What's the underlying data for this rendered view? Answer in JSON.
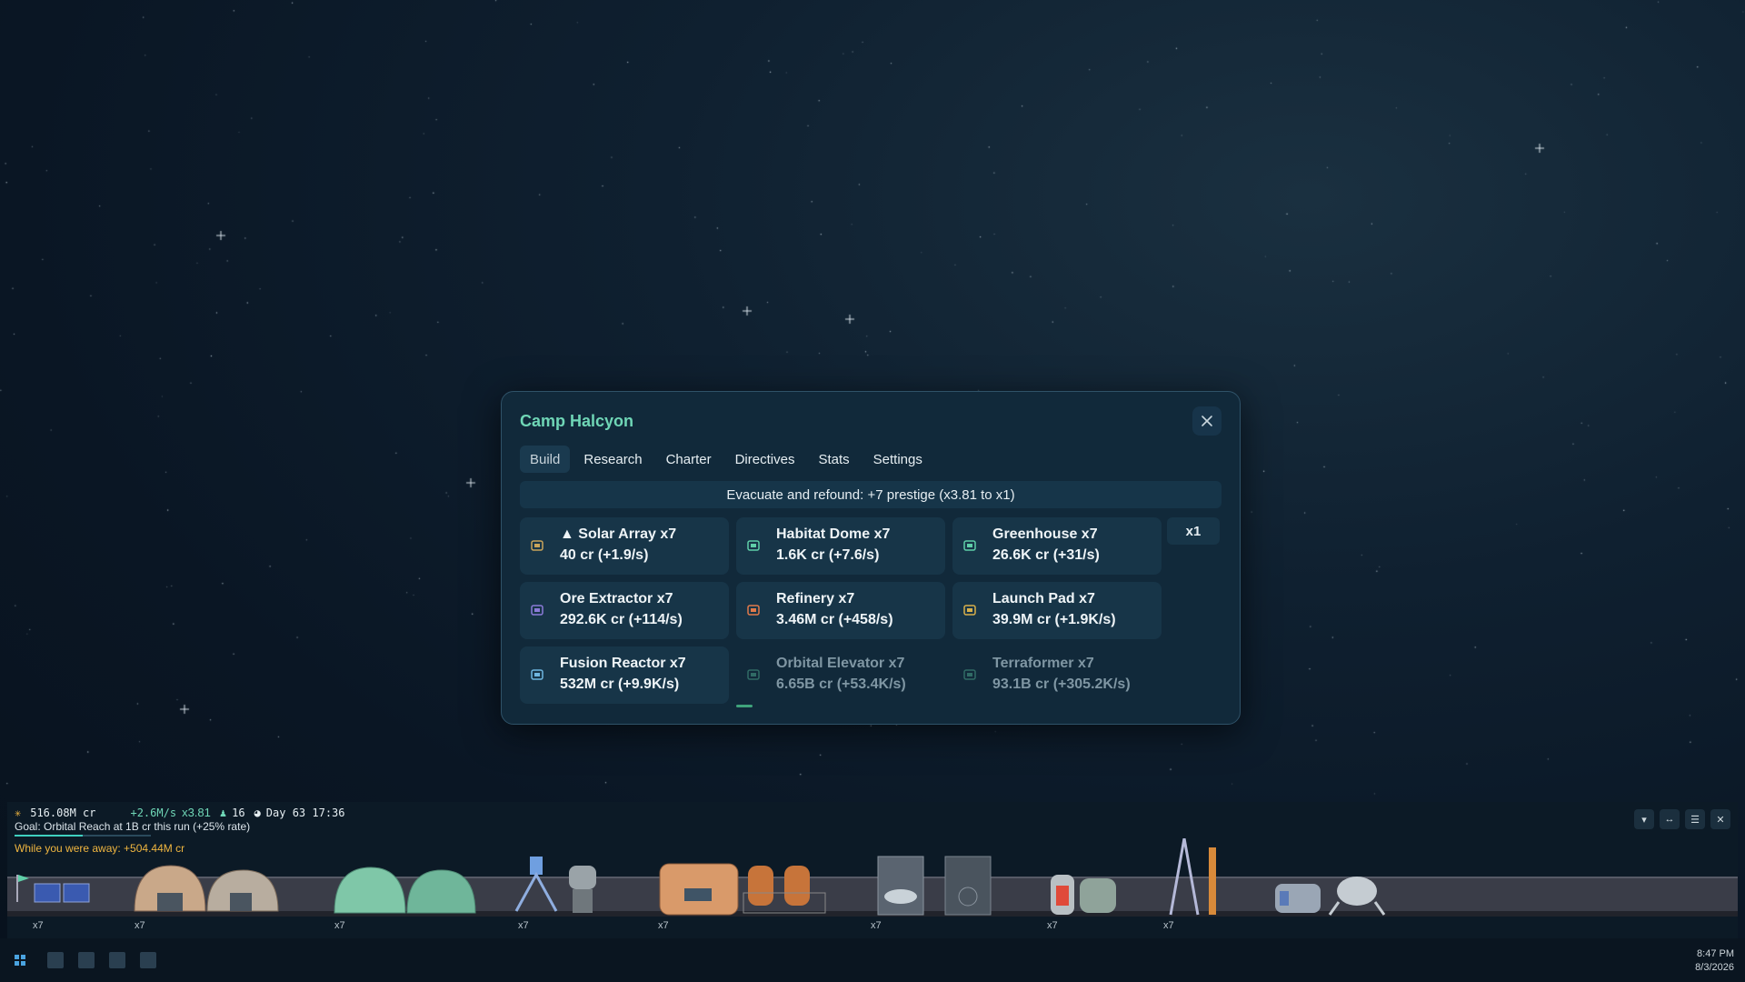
{
  "window": {
    "title": "Camp Halcyon"
  },
  "tabs": [
    {
      "label": "Build",
      "active": true
    },
    {
      "label": "Research"
    },
    {
      "label": "Charter"
    },
    {
      "label": "Directives"
    },
    {
      "label": "Stats"
    },
    {
      "label": "Settings"
    }
  ],
  "banner": "Evacuate and refound: +7 prestige (x3.81 to x1)",
  "multiplier_button": "x1",
  "buildings": [
    {
      "name": "▲ Solar Array x7",
      "cost": "40 cr  (+1.9/s)",
      "icon": "solar-panel-icon",
      "color": "#c9a45a"
    },
    {
      "name": "Habitat Dome x7",
      "cost": "1.6K cr  (+7.6/s)",
      "icon": "dome-icon",
      "color": "#5fcfa8"
    },
    {
      "name": "Greenhouse x7",
      "cost": "26.6K cr  (+31/s)",
      "icon": "greenhouse-icon",
      "color": "#5fcfa8"
    },
    {
      "name": "Ore Extractor x7",
      "cost": "292.6K cr  (+114/s)",
      "icon": "drill-icon",
      "color": "#8b7bd8"
    },
    {
      "name": "Refinery x7",
      "cost": "3.46M cr  (+458/s)",
      "icon": "refinery-icon",
      "color": "#e07a4a"
    },
    {
      "name": "Launch Pad x7",
      "cost": "39.9M cr  (+1.9K/s)",
      "icon": "launch-pad-icon",
      "color": "#d8b04a"
    },
    {
      "name": "Fusion Reactor x7",
      "cost": "532M cr  (+9.9K/s)",
      "icon": "reactor-icon",
      "color": "#6fb6e0"
    },
    {
      "name": "Orbital Elevator x7",
      "cost": "6.65B cr  (+53.4K/s)",
      "icon": "elevator-icon",
      "color": "#5fcfa8",
      "locked": true,
      "progress": 0.08
    },
    {
      "name": "Terraformer x7",
      "cost": "93.1B cr  (+305.2K/s)",
      "icon": "terraformer-icon",
      "color": "#5fcfa8",
      "locked": true
    }
  ],
  "hud": {
    "credits": "516.08M cr",
    "rate": "+2.6M/s",
    "multiplier": "x3.81",
    "colonists": "16",
    "day": "Day 63 17:36",
    "goal": "Goal: Orbital Reach at 1B cr this run (+25% rate)",
    "goal_progress": 0.5,
    "away": "While you were away: +504.44M cr"
  },
  "colony_counts": [
    "x7",
    "x7",
    "x7",
    "x7",
    "x7",
    "x7",
    "x7",
    "x7"
  ],
  "colony_controls": [
    "▾",
    "↔",
    "☰",
    "✕"
  ],
  "taskbar": {
    "time": "8:47 PM",
    "date": "8/3/2026"
  },
  "colors": {
    "accent": "#6fd6b6",
    "gold": "#f0b640",
    "panel": "#11293a"
  }
}
